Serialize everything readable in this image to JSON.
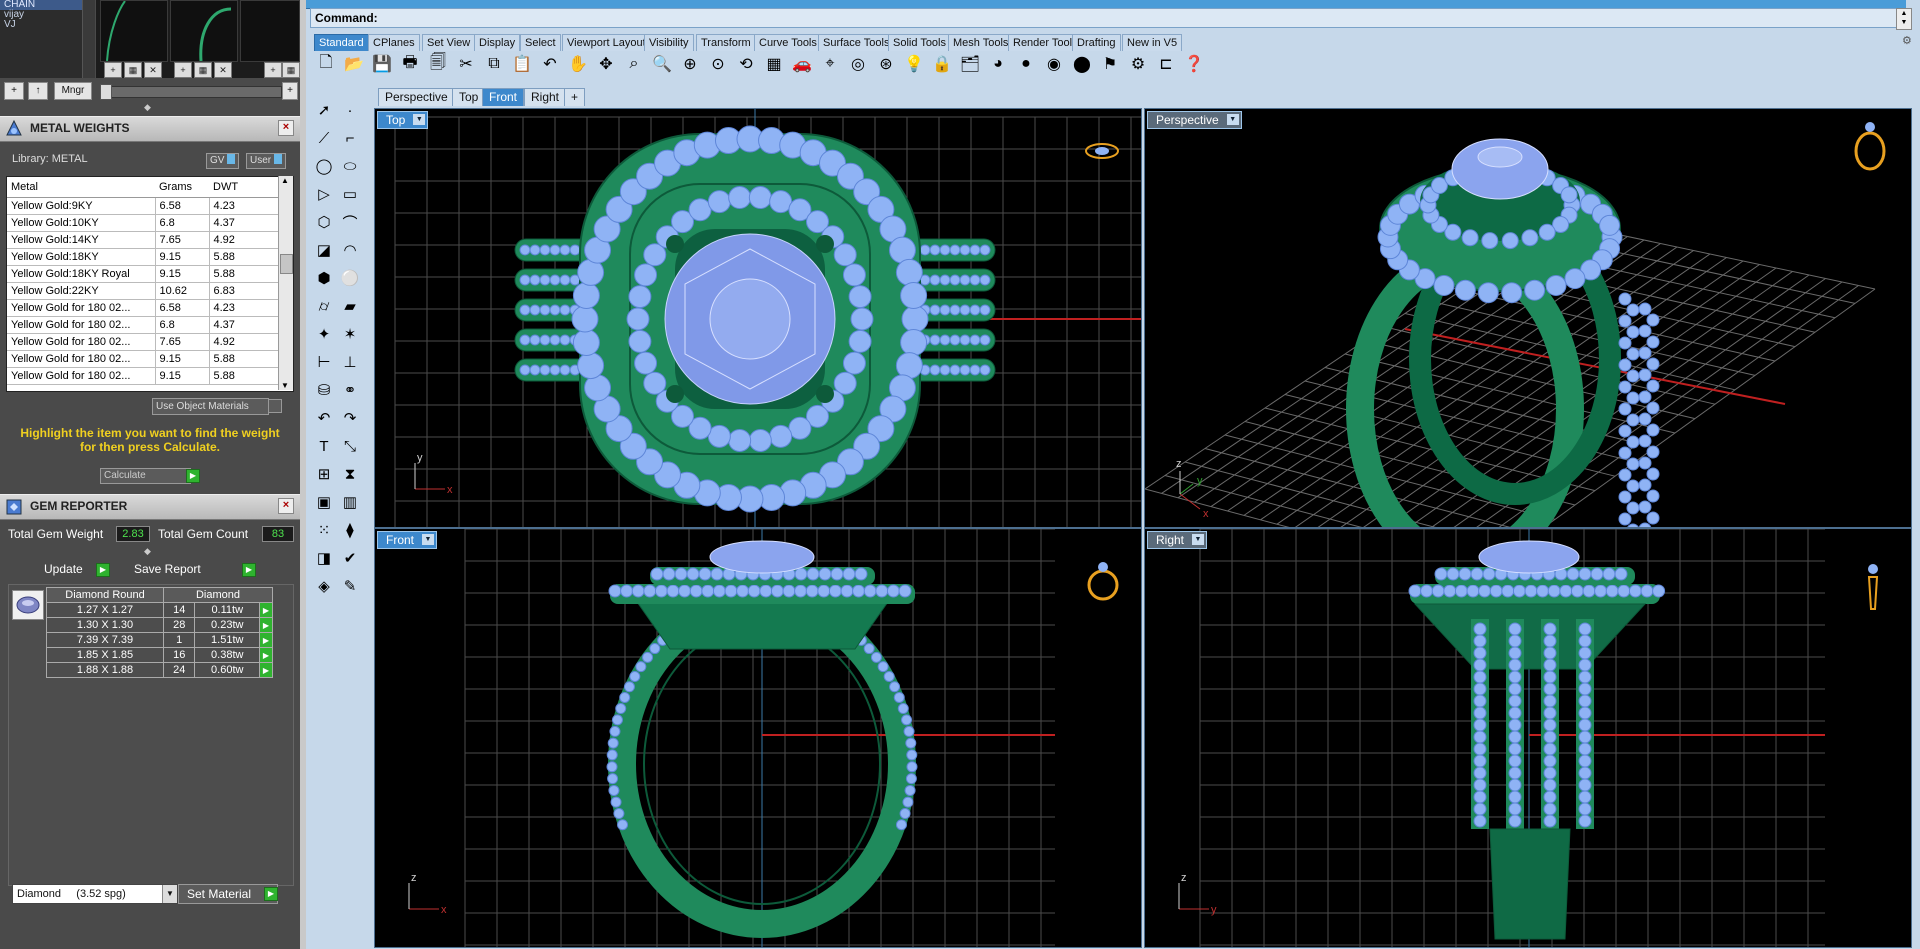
{
  "layers": {
    "items": [
      "CHAIN",
      "vijay",
      "VJ"
    ],
    "mngr_label": "Mngr"
  },
  "metal_weights": {
    "title": "METAL WEIGHTS",
    "library_label": "Library: METAL",
    "gv_label": "GV",
    "user_label": "User",
    "columns": [
      "Metal",
      "Grams",
      "DWT"
    ],
    "rows": [
      [
        "Yellow Gold:9KY",
        "6.58",
        "4.23"
      ],
      [
        "Yellow Gold:10KY",
        "6.8",
        "4.37"
      ],
      [
        "Yellow Gold:14KY",
        "7.65",
        "4.92"
      ],
      [
        "Yellow Gold:18KY",
        "9.15",
        "5.88"
      ],
      [
        "Yellow Gold:18KY Royal",
        "9.15",
        "5.88"
      ],
      [
        "Yellow Gold:22KY",
        "10.62",
        "6.83"
      ],
      [
        "Yellow Gold for 180 02...",
        "6.58",
        "4.23"
      ],
      [
        "Yellow Gold for 180 02...",
        "6.8",
        "4.37"
      ],
      [
        "Yellow Gold for 180 02...",
        "7.65",
        "4.92"
      ],
      [
        "Yellow Gold for 180 02...",
        "9.15",
        "5.88"
      ],
      [
        "Yellow Gold for 180 02...",
        "9.15",
        "5.88"
      ]
    ],
    "use_object_materials": "Use Object Materials",
    "hint": "Highlight the item you want to find the weight for then press Calculate.",
    "calculate_placeholder": "Calculate"
  },
  "gem_reporter": {
    "title": "GEM REPORTER",
    "total_weight_label": "Total Gem Weight",
    "total_weight": "2.83",
    "total_count_label": "Total Gem Count",
    "total_count": "83",
    "update_label": "Update",
    "save_label": "Save Report",
    "columns": [
      "Diamond Round",
      "Diamond"
    ],
    "rows": [
      [
        "1.27 X 1.27",
        "14",
        "0.11tw"
      ],
      [
        "1.30 X 1.30",
        "28",
        "0.23tw"
      ],
      [
        "7.39 X 7.39",
        "1",
        "1.51tw"
      ],
      [
        "1.85 X 1.85",
        "16",
        "0.38tw"
      ],
      [
        "1.88 X 1.88",
        "24",
        "0.60tw"
      ]
    ],
    "material_value": "Diamond     (3.52 spg)",
    "set_material_label": "Set Material"
  },
  "command": {
    "label": "Command:"
  },
  "toolbar_tabs": [
    "Standard",
    "CPlanes",
    "Set View",
    "Display",
    "Select",
    "Viewport Layout",
    "Visibility",
    "Transform",
    "Curve Tools",
    "Surface Tools",
    "Solid Tools",
    "Mesh Tools",
    "Render Tools",
    "Drafting",
    "New in V5"
  ],
  "viewport_tabs": [
    "Perspective",
    "Top",
    "Front",
    "Right",
    "+"
  ],
  "viewports": {
    "top": {
      "label": "Top",
      "axis1": "x",
      "axis2": "y"
    },
    "perspective": {
      "label": "Perspective",
      "axis1": "x",
      "axis2": "y",
      "axis3": "z"
    },
    "front": {
      "label": "Front",
      "axis1": "x",
      "axis2": "z"
    },
    "right": {
      "label": "Right",
      "axis1": "y",
      "axis2": "z"
    }
  },
  "colors": {
    "metal": "#1f8a5c",
    "gem": "#8fb3f5",
    "gem_stroke": "#5e86d8",
    "accent": "#3d88cc",
    "grid": "#4b4b4b"
  }
}
